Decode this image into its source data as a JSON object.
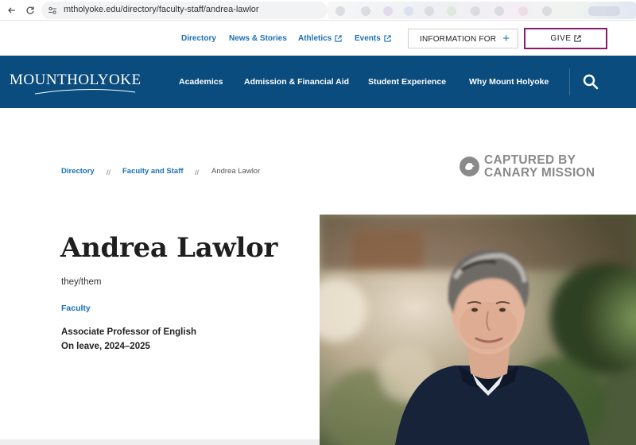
{
  "browser": {
    "url": "mtholyoke.edu/directory/faculty-staff/andrea-lawlor"
  },
  "utility_nav": {
    "links": [
      {
        "label": "Directory",
        "external": false
      },
      {
        "label": "News & Stories",
        "external": false
      },
      {
        "label": "Athletics",
        "external": true
      },
      {
        "label": "Events",
        "external": true
      }
    ],
    "information_for": "INFORMATION FOR",
    "give": "GIVE"
  },
  "main_nav": {
    "logo": "MOUNTHOLYOKE",
    "items": [
      "Academics",
      "Admission & Financial Aid",
      "Student Experience",
      "Why Mount Holyoke"
    ]
  },
  "breadcrumb": {
    "items": [
      "Directory",
      "Faculty and Staff",
      "Andrea Lawlor"
    ],
    "separator": "//"
  },
  "watermark": {
    "line1": "CAPTURED BY",
    "line2": "CANARY MISSION"
  },
  "profile": {
    "name": "Andrea Lawlor",
    "pronouns": "they/them",
    "category": "Faculty",
    "titles": [
      "Associate Professor of English",
      "On leave, 2024–2025"
    ]
  },
  "colors": {
    "nav_blue": "#0a4c7e",
    "link_blue": "#1a6fb5",
    "give_border": "#8e1a6b"
  }
}
